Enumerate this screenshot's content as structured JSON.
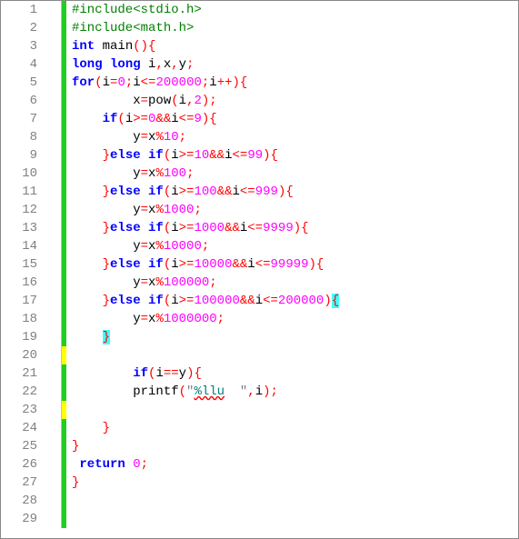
{
  "chart_data": null,
  "editor": {
    "lines": [
      {
        "n": 1,
        "mark": "green",
        "html": "<span class='pp'>#include&lt;stdio.h&gt;</span>"
      },
      {
        "n": 2,
        "mark": "green",
        "html": "<span class='pp'>#include&lt;math.h&gt;</span>"
      },
      {
        "n": 3,
        "mark": "green",
        "html": "<span class='kw'>int</span> <span class='id'>main</span><span class='op'>(){</span>"
      },
      {
        "n": 4,
        "mark": "green",
        "html": "<span class='kw'>long</span> <span class='kw'>long</span> <span class='id'>i</span><span class='op'>,</span><span class='id'>x</span><span class='op'>,</span><span class='id'>y</span><span class='op'>;</span>"
      },
      {
        "n": 5,
        "mark": "green",
        "html": "<span class='kw'>for</span><span class='op'>(</span><span class='id'>i</span><span class='op'>=</span><span class='num'>0</span><span class='op'>;</span><span class='id'>i</span><span class='op'>&lt;=</span><span class='num'>200000</span><span class='op'>;</span><span class='id'>i</span><span class='op'>++){</span>"
      },
      {
        "n": 6,
        "mark": "green",
        "html": "        <span class='id'>x</span><span class='op'>=</span><span class='id'>pow</span><span class='op'>(</span><span class='id'>i</span><span class='op'>,</span><span class='num'>2</span><span class='op'>);</span>"
      },
      {
        "n": 7,
        "mark": "green",
        "html": "    <span class='kw'>if</span><span class='op'>(</span><span class='id'>i</span><span class='op'>&gt;=</span><span class='num'>0</span><span class='op'>&amp;&amp;</span><span class='id'>i</span><span class='op'>&lt;=</span><span class='num'>9</span><span class='op'>){</span>"
      },
      {
        "n": 8,
        "mark": "green",
        "html": "        <span class='id'>y</span><span class='op'>=</span><span class='id'>x</span><span class='op'>%</span><span class='num'>10</span><span class='op'>;</span>"
      },
      {
        "n": 9,
        "mark": "green",
        "html": "    <span class='op'>}</span><span class='kw'>else</span> <span class='kw'>if</span><span class='op'>(</span><span class='id'>i</span><span class='op'>&gt;=</span><span class='num'>10</span><span class='op'>&amp;&amp;</span><span class='id'>i</span><span class='op'>&lt;=</span><span class='num'>99</span><span class='op'>){</span>"
      },
      {
        "n": 10,
        "mark": "green",
        "html": "        <span class='id'>y</span><span class='op'>=</span><span class='id'>x</span><span class='op'>%</span><span class='num'>100</span><span class='op'>;</span>"
      },
      {
        "n": 11,
        "mark": "green",
        "html": "    <span class='op'>}</span><span class='kw'>else</span> <span class='kw'>if</span><span class='op'>(</span><span class='id'>i</span><span class='op'>&gt;=</span><span class='num'>100</span><span class='op'>&amp;&amp;</span><span class='id'>i</span><span class='op'>&lt;=</span><span class='num'>999</span><span class='op'>){</span>"
      },
      {
        "n": 12,
        "mark": "green",
        "html": "        <span class='id'>y</span><span class='op'>=</span><span class='id'>x</span><span class='op'>%</span><span class='num'>1000</span><span class='op'>;</span>"
      },
      {
        "n": 13,
        "mark": "green",
        "html": "    <span class='op'>}</span><span class='kw'>else</span> <span class='kw'>if</span><span class='op'>(</span><span class='id'>i</span><span class='op'>&gt;=</span><span class='num'>1000</span><span class='op'>&amp;&amp;</span><span class='id'>i</span><span class='op'>&lt;=</span><span class='num'>9999</span><span class='op'>){</span>"
      },
      {
        "n": 14,
        "mark": "green",
        "html": "        <span class='id'>y</span><span class='op'>=</span><span class='id'>x</span><span class='op'>%</span><span class='num'>10000</span><span class='op'>;</span>"
      },
      {
        "n": 15,
        "mark": "green",
        "html": "    <span class='op'>}</span><span class='kw'>else</span> <span class='kw'>if</span><span class='op'>(</span><span class='id'>i</span><span class='op'>&gt;=</span><span class='num'>10000</span><span class='op'>&amp;&amp;</span><span class='id'>i</span><span class='op'>&lt;=</span><span class='num'>99999</span><span class='op'>){</span>"
      },
      {
        "n": 16,
        "mark": "green",
        "html": "        <span class='id'>y</span><span class='op'>=</span><span class='id'>x</span><span class='op'>%</span><span class='num'>100000</span><span class='op'>;</span>"
      },
      {
        "n": 17,
        "mark": "green",
        "html": "    <span class='op'>}</span><span class='kw'>else</span> <span class='kw'>if</span><span class='op'>(</span><span class='id'>i</span><span class='op'>&gt;=</span><span class='num'>100000</span><span class='op'>&amp;&amp;</span><span class='id'>i</span><span class='op'>&lt;=</span><span class='num'>200000</span><span class='op'>)</span><span class='op hl'>{</span>"
      },
      {
        "n": 18,
        "mark": "green",
        "html": "        <span class='id'>y</span><span class='op'>=</span><span class='id'>x</span><span class='op'>%</span><span class='num'>1000000</span><span class='op'>;</span>"
      },
      {
        "n": 19,
        "mark": "green",
        "html": "    <span class='op hl'>}</span>"
      },
      {
        "n": 20,
        "mark": "yellow",
        "html": ""
      },
      {
        "n": 21,
        "mark": "green",
        "html": "        <span class='kw'>if</span><span class='op'>(</span><span class='id'>i</span><span class='op'>==</span><span class='id'>y</span><span class='op'>){</span>"
      },
      {
        "n": 22,
        "mark": "green",
        "html": "        <span class='id'>printf</span><span class='op'>(</span><span class='str'>\"</span><span class='fmt squig'>%llu</span><span class='str'>  \"</span><span class='op'>,</span><span class='id'>i</span><span class='op'>);</span>"
      },
      {
        "n": 23,
        "mark": "yellow",
        "html": ""
      },
      {
        "n": 24,
        "mark": "green",
        "html": "    <span class='op'>}</span>"
      },
      {
        "n": 25,
        "mark": "green",
        "html": "<span class='op'>}</span>"
      },
      {
        "n": 26,
        "mark": "green",
        "html": " <span class='kw'>return</span> <span class='num'>0</span><span class='op'>;</span>"
      },
      {
        "n": 27,
        "mark": "green",
        "html": "<span class='op'>}</span>"
      },
      {
        "n": 28,
        "mark": "green",
        "html": ""
      },
      {
        "n": 29,
        "mark": "green",
        "html": ""
      }
    ]
  }
}
